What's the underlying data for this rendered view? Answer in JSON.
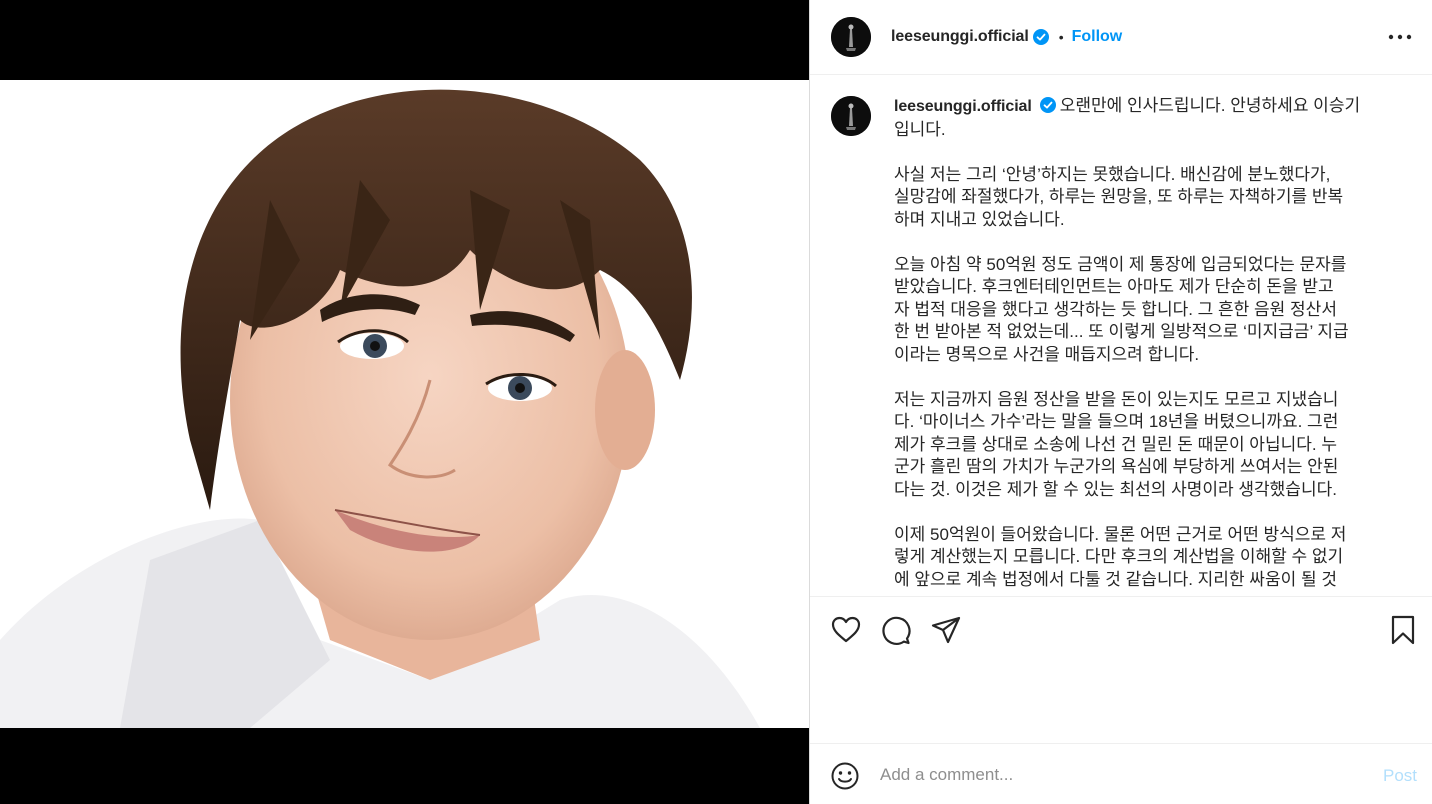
{
  "post": {
    "username": "leeseunggi.official",
    "dot": "•",
    "follow_label": "Follow",
    "caption_first": "오랜만에 인사드립니다. 안녕하세요 이승기",
    "caption_lines": [
      [
        "입니다."
      ],
      [
        "사실 저는 그리 ‘안녕’하지는 못했습니다. 배신감에 분노했다가,",
        "실망감에 좌절했다가, 하루는 원망을, 또 하루는 자책하기를 반복",
        "하며 지내고 있었습니다."
      ],
      [
        "오늘 아침 약 50억원 정도 금액이 제 통장에 입금되었다는 문자를",
        "받았습니다. 후크엔터테인먼트는 아마도 제가 단순히 돈을 받고",
        "자 법적 대응을 했다고 생각하는 듯 합니다. 그 흔한 음원 정산서",
        "한 번 받아본 적 없었는데... 또 이렇게 일방적으로 ‘미지급금’ 지급",
        "이라는 명목으로 사건을 매듭지으려 합니다."
      ],
      [
        "저는 지금까지 음원 정산을 받을 돈이 있는지도 모르고 지냈습니",
        "다. ‘마이너스 가수’라는 말을 들으며 18년을 버텼으니까요. 그런",
        "제가 후크를 상대로 소송에 나선 건 밀린 돈 때문이 아닙니다. 누",
        "군가 흘린 땀의 가치가 누군가의 욕심에 부당하게 쓰여서는 안된",
        "다는 것. 이것은 제가 할 수 있는 최선의 사명이라 생각했습니다."
      ],
      [
        "이제 50억원이 들어왔습니다. 물론 어떤 근거로 어떤 방식으로 저",
        "렇게 계산했는지 모릅니다. 다만 후크의 계산법을 이해할 수 없기",
        "에 앞으로 계속 법정에서 다툴 것 같습니다. 지리한 싸움이 될 것"
      ]
    ]
  },
  "comment": {
    "placeholder": "Add a comment...",
    "post_label": "Post"
  },
  "colors": {
    "accent": "#0095f6",
    "post_disabled": "#b2dffc",
    "text": "#262626",
    "muted": "#8e8e8e"
  },
  "icons": [
    "more-options-icon",
    "verified-badge-icon",
    "heart-icon",
    "comment-icon",
    "share-icon",
    "bookmark-icon",
    "emoji-icon"
  ]
}
